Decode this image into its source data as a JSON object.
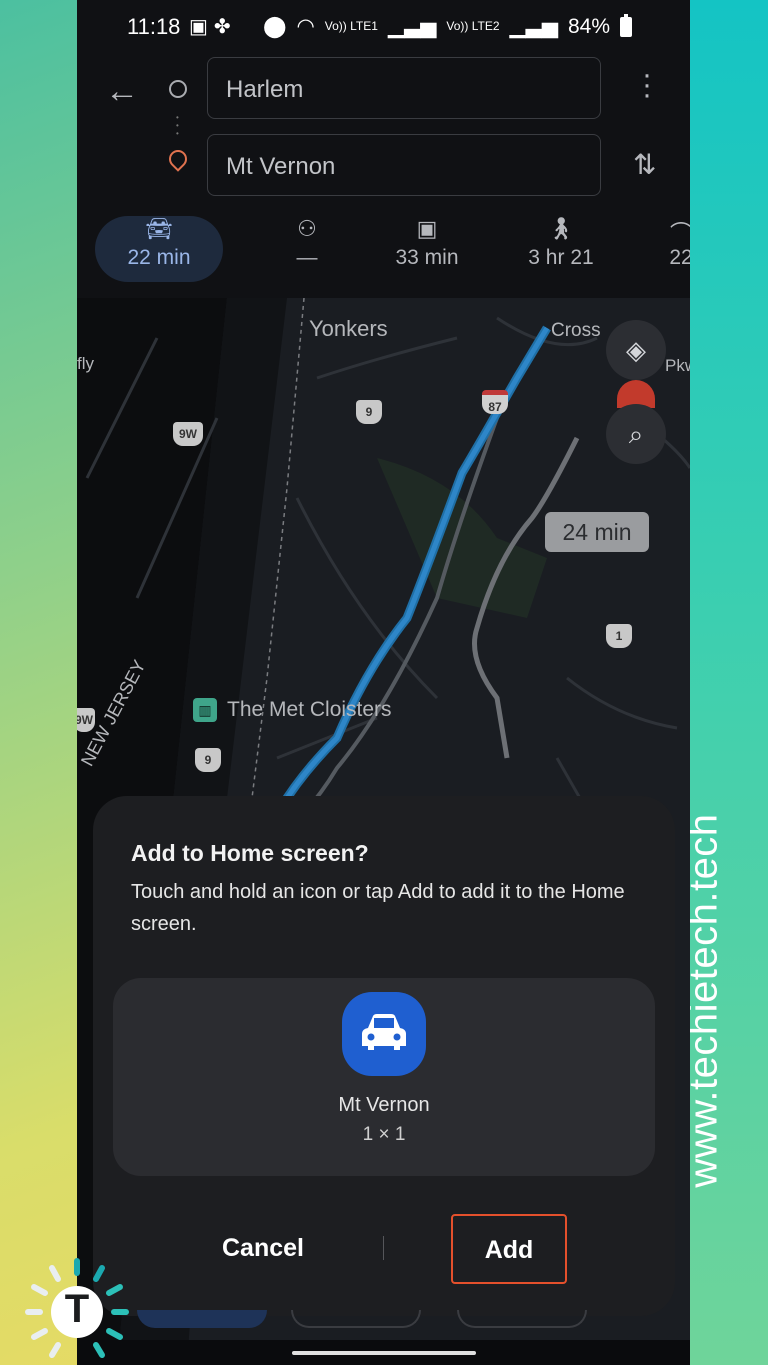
{
  "status_bar": {
    "time": "11:18",
    "signal_label_1": "Vo)) LTE1",
    "signal_label_2": "Vo)) LTE2",
    "battery": "84%"
  },
  "directions": {
    "origin": "Harlem",
    "destination": "Mt Vernon",
    "modes": [
      {
        "icon": "car-icon",
        "label": "22 min",
        "active": true
      },
      {
        "icon": "motorcycle-icon",
        "label": "—"
      },
      {
        "icon": "train-icon",
        "label": "33 min"
      },
      {
        "icon": "walk-icon",
        "label": "3 hr 21"
      },
      {
        "icon": "bike-icon",
        "label": "22"
      }
    ]
  },
  "map": {
    "labels": {
      "yonkers": "Yonkers",
      "cross": "Cross",
      "pkwy": "Pkw",
      "fly": "fly",
      "met_cloisters": "The Met Cloisters",
      "new_jersey": "NEW JERSEY"
    },
    "shields": {
      "r9": "9",
      "r9w": "9W",
      "r87": "87",
      "r1": "1",
      "r9b": "9",
      "r9w_left": "9W"
    },
    "eta_bubble": "24 min"
  },
  "dialog": {
    "title": "Add to Home screen?",
    "description": "Touch and hold an icon or tap Add to add it to the Home screen.",
    "widget_name": "Mt Vernon",
    "widget_size": "1 × 1",
    "cancel_label": "Cancel",
    "add_label": "Add"
  },
  "watermark": "www.techietech.tech",
  "logo_letter": "T",
  "colors": {
    "accent_blue": "#1f5fd0",
    "route_blue": "#2e86c8",
    "add_highlight": "#e4502c"
  }
}
